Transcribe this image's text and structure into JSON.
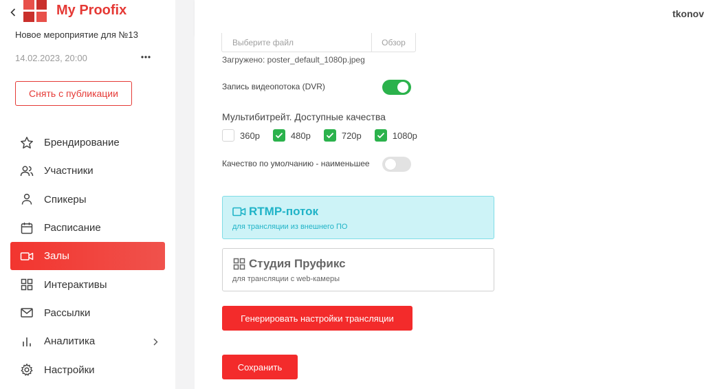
{
  "sidebar": {
    "app_title": "My Proofix",
    "event_name": "Новое мероприятие для №13",
    "event_date": "14.02.2023, 20:00",
    "more_label": "•••",
    "unpublish_label": "Снять с публикации",
    "nav": [
      {
        "label": "Брендирование",
        "icon": "star-icon"
      },
      {
        "label": "Участники",
        "icon": "users-icon"
      },
      {
        "label": "Спикеры",
        "icon": "user-icon"
      },
      {
        "label": "Расписание",
        "icon": "calendar-icon"
      },
      {
        "label": "Залы",
        "icon": "video-camera-icon",
        "active": true
      },
      {
        "label": "Интерактивы",
        "icon": "grid-icon"
      },
      {
        "label": "Рассылки",
        "icon": "mail-icon"
      },
      {
        "label": "Аналитика",
        "icon": "bar-chart-icon",
        "has_submenu": true
      },
      {
        "label": "Настройки",
        "icon": "gear-icon"
      }
    ]
  },
  "topbar": {
    "username": "tkonov"
  },
  "main": {
    "file_placeholder": "Выберите файл",
    "browse_label": "Обзор",
    "uploaded_text": "Загружено: poster_default_1080p.jpeg",
    "dvr_label": "Запись видеопотока (DVR)",
    "dvr_enabled": true,
    "multibitrate_title": "Мультибитрейт. Доступные качества",
    "qualities": [
      {
        "label": "360p",
        "checked": false
      },
      {
        "label": "480p",
        "checked": true
      },
      {
        "label": "720p",
        "checked": true
      },
      {
        "label": "1080p",
        "checked": true
      }
    ],
    "default_quality_label": "Качество по умолчанию - наименьшее",
    "default_quality_enabled": false,
    "stream_options": [
      {
        "title": "RTMP-поток",
        "subtitle": "для трансляции из внешнего ПО",
        "icon": "video-camera-icon",
        "selected": true
      },
      {
        "title": "Студия Пруфикс",
        "subtitle": "для трансляции с web-камеры",
        "icon": "grid-icon",
        "selected": false
      }
    ],
    "generate_label": "Генерировать настройки трансляции",
    "save_label": "Сохранить"
  },
  "colors": {
    "brand_red": "#e53935",
    "button_red": "#f32b2b",
    "toggle_green": "#2bb24c",
    "selected_card_bg": "#cdf3f7",
    "selected_card_text": "#1fb3c7"
  }
}
